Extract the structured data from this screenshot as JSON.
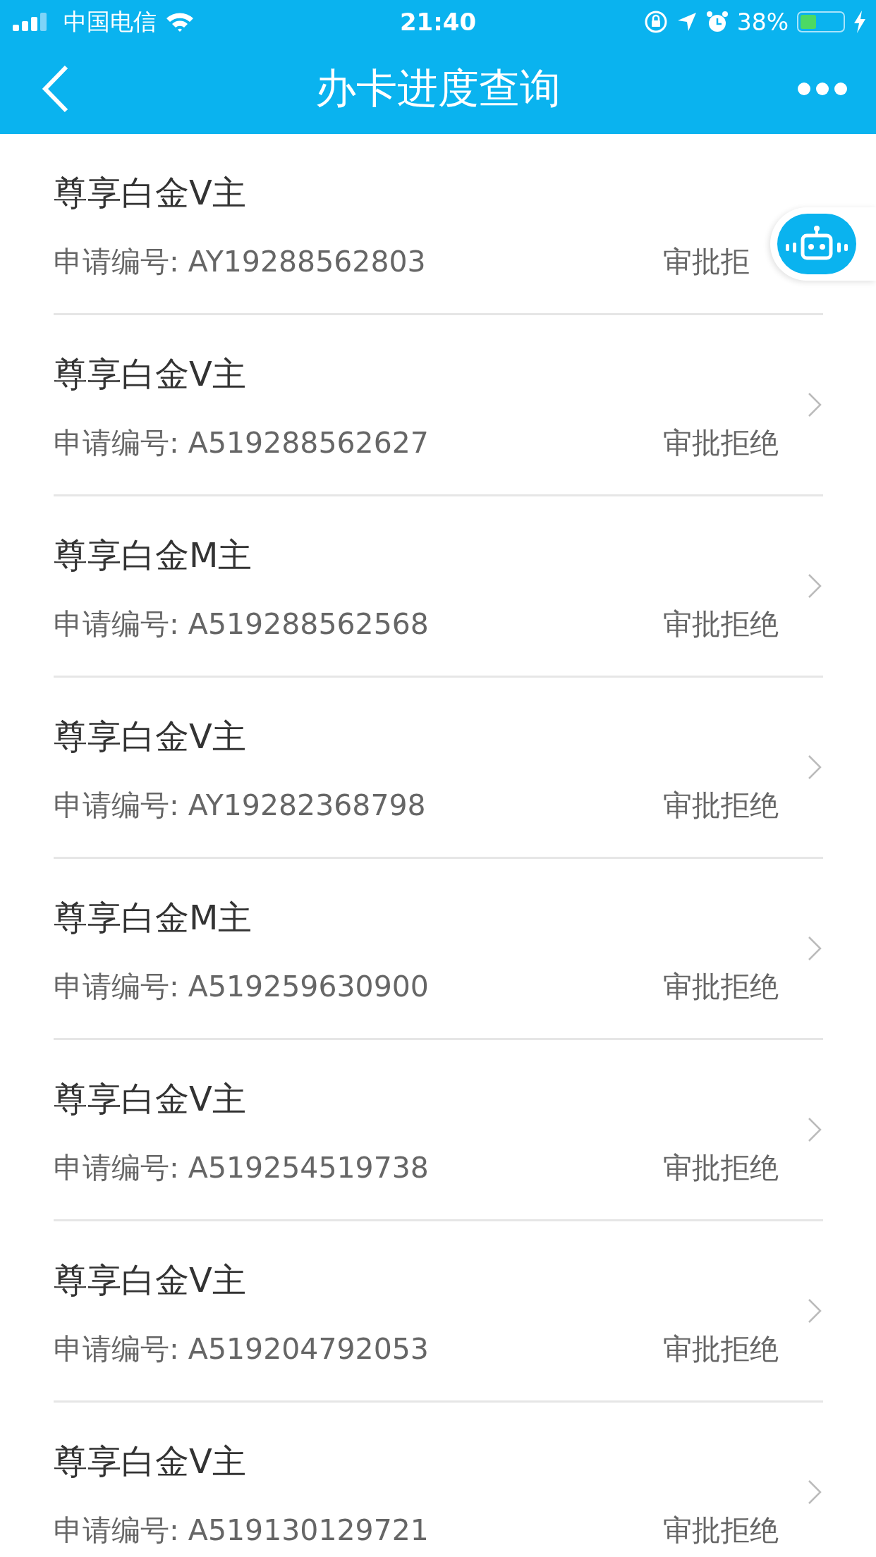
{
  "status_bar": {
    "carrier": "中国电信",
    "time": "21:40",
    "battery_percent": "38%",
    "charging": true
  },
  "nav_bar": {
    "title": "办卡进度查询"
  },
  "applications": [
    {
      "card": "尊享白金V主",
      "number_label": "申请编号: AY19288562803",
      "status": "审批拒"
    },
    {
      "card": "尊享白金V主",
      "number_label": "申请编号: A519288562627",
      "status": "审批拒绝"
    },
    {
      "card": "尊享白金M主",
      "number_label": "申请编号: A519288562568",
      "status": "审批拒绝"
    },
    {
      "card": "尊享白金V主",
      "number_label": "申请编号: AY19282368798",
      "status": "审批拒绝"
    },
    {
      "card": "尊享白金M主",
      "number_label": "申请编号: A519259630900",
      "status": "审批拒绝"
    },
    {
      "card": "尊享白金V主",
      "number_label": "申请编号: A519254519738",
      "status": "审批拒绝"
    },
    {
      "card": "尊享白金V主",
      "number_label": "申请编号: A519204792053",
      "status": "审批拒绝"
    },
    {
      "card": "尊享白金V主",
      "number_label": "申请编号: A519130129721",
      "status": "审批拒绝"
    }
  ]
}
